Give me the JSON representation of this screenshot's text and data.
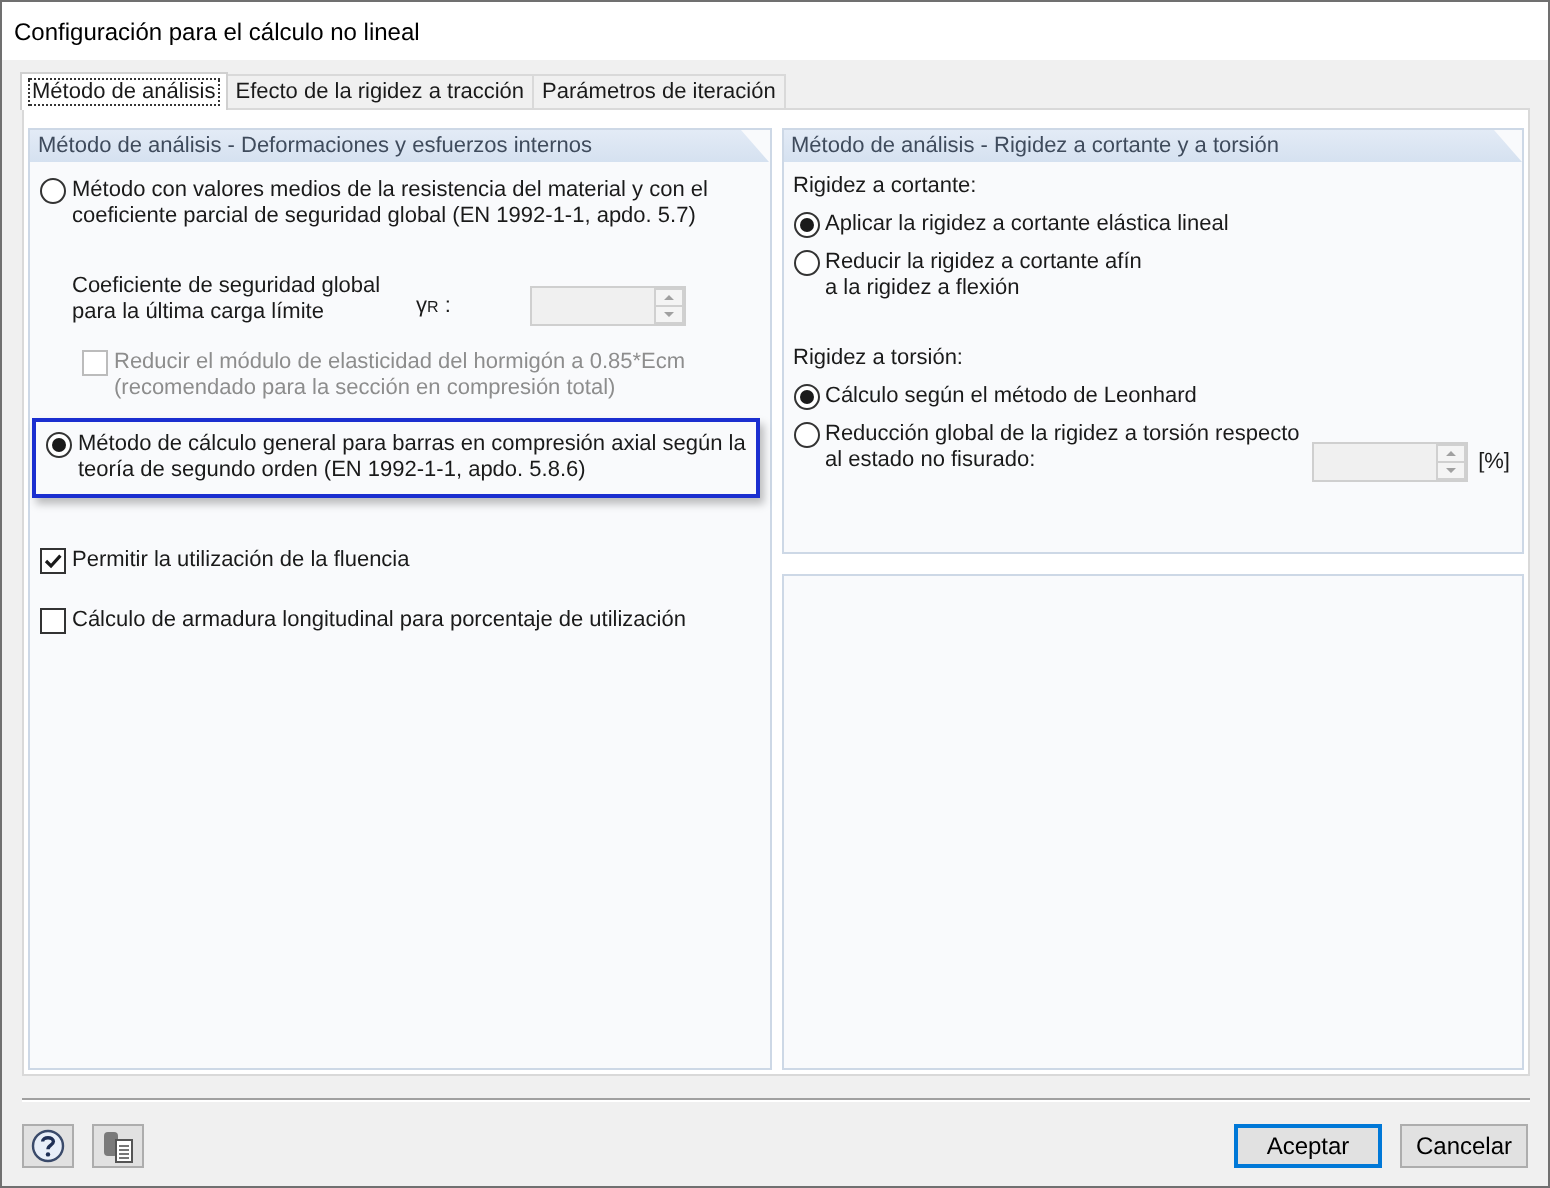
{
  "window": {
    "title": "Configuración para el cálculo no lineal"
  },
  "tabs": [
    {
      "label": "Método de análisis",
      "selected": true
    },
    {
      "label": "Efecto de la rigidez a tracción",
      "selected": false
    },
    {
      "label": "Parámetros de iteración",
      "selected": false
    }
  ],
  "analysis_group": {
    "title": "Método de análisis - Deformaciones y esfuerzos internos",
    "items": [
      {
        "kind": "radio",
        "label": "Método con valores medios de la resistencia del material y con el\ncoeficiente parcial de seguridad global (EN 1992-1-1, apdo. 5.7)",
        "selected": false,
        "highlighted": false
      },
      {
        "kind": "factor",
        "label": "Coeficiente de seguridad global\npara la última carga límite",
        "symbol": "γ$_{R}$ :",
        "disabled": true
      },
      {
        "kind": "sub_checkbox",
        "label": "Reducir el módulo de elasticidad del hormigón a 0.85*Ecm\n(recomendado para la sección en compresión total)",
        "checked": false,
        "disabled": true
      },
      {
        "kind": "radio",
        "label": "Método de cálculo general para barras en compresión axial según la\nteoría de segundo orden (EN 1992-1-1, apdo. 5.8.6)",
        "selected": true,
        "highlighted": true
      },
      {
        "kind": "checkbox",
        "label": "Permitir la utilización de la fluencia",
        "checked": true,
        "disabled": false
      },
      {
        "kind": "checkbox",
        "label": "Cálculo de armadura longitudinal para porcentaje de utilización",
        "checked": false,
        "disabled": false
      }
    ]
  },
  "stiffness_group": {
    "title": "Método de análisis - Rigidez a cortante y a torsión",
    "items": [
      {
        "kind": "heading",
        "label": "Rigidez a cortante:"
      },
      {
        "kind": "radio",
        "label": "Aplicar la rigidez a cortante elástica lineal",
        "selected": true
      },
      {
        "kind": "radio",
        "label": "Reducir la rigidez a cortante afín\na la rigidez a flexión",
        "selected": false
      },
      {
        "kind": "heading",
        "label": "Rigidez a torsión:"
      },
      {
        "kind": "radio",
        "label": "Cálculo según el método de Leonhard",
        "selected": true
      },
      {
        "kind": "radio",
        "label": "Reducción global de la rigidez a torsión respecto\nal estado no fisurado:",
        "selected": false,
        "field": {
          "disabled": true,
          "unit": "[%]"
        }
      }
    ]
  },
  "buttons": [
    {
      "label": "Aceptar",
      "default": true
    },
    {
      "label": "Cancelar",
      "default": false
    }
  ]
}
